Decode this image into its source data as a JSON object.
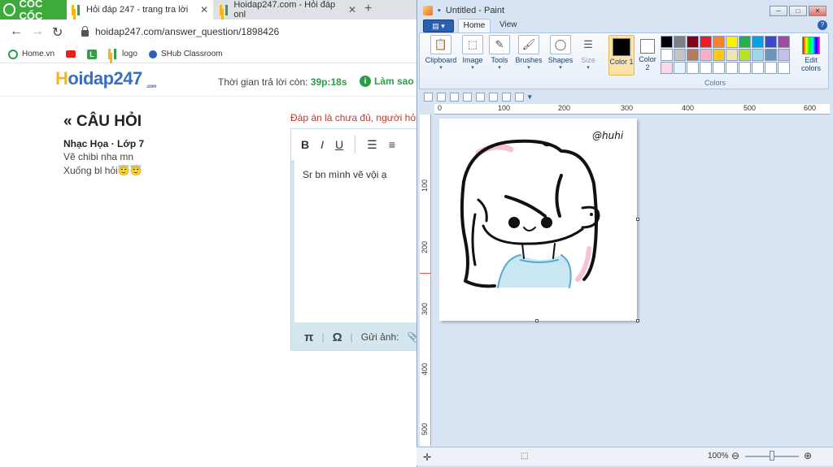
{
  "browser": {
    "brand": "CỐC CỐC",
    "tabs": [
      {
        "title": "Hỏi đáp 247 - trang tra lời",
        "active": true
      },
      {
        "title": "Hoidap247.com - Hỏi đáp onl",
        "active": false
      }
    ],
    "url": "hoidap247.com/answer_question/1898426",
    "bookmarks": [
      "Home.vn",
      "L",
      "logo",
      "SHub Classroom"
    ],
    "icons": {
      "back": "arrow-left-icon",
      "forward": "arrow-right-icon",
      "reload": "reload-icon",
      "new_tab": "plus-icon",
      "close": "close-icon"
    }
  },
  "page": {
    "logo_main_a": "H",
    "logo_main_b": "oidap247",
    "logo_sub": ".com",
    "timer_label": "Thời gian trả lời còn:",
    "timer_value": "39p:18s",
    "hint": "Làm sao",
    "question_header": "CÂU HỎI",
    "question_meta": "Nhạc Họa · Lớp 7",
    "question_lines": [
      "Vẽ chibi nha mn",
      "Xuống bl hỏi😇😇"
    ],
    "warning": "Đáp án là chưa đủ, người hỏi",
    "editor": {
      "tools": [
        "B",
        "I",
        "U"
      ],
      "content": "Sr bn mình vẽ vội ạ",
      "bottom_pi": "π",
      "bottom_omega": "Ω",
      "send_image": "Gửi ảnh:"
    }
  },
  "paint": {
    "title": "Untitled - Paint",
    "tabs": [
      "Home",
      "View"
    ],
    "groups": [
      "Clipboard",
      "Image",
      "Tools",
      "Brushes",
      "Shapes",
      "Size"
    ],
    "color1": "Color 1",
    "color2": "Color 2",
    "colors_label": "Colors",
    "edit_colors": "Edit colors",
    "palette": [
      "#000000",
      "#7f7f7f",
      "#880015",
      "#ed1c24",
      "#ff7f27",
      "#fff200",
      "#22b14c",
      "#00a2e8",
      "#3f48cc",
      "#a349a4",
      "#ffffff",
      "#c3c3c3",
      "#b97a57",
      "#ffaec9",
      "#ffc90e",
      "#efe4b0",
      "#b5e61d",
      "#99d9ea",
      "#7092be",
      "#c8bfe7",
      "#ffd6e4",
      "#e8f4fb",
      "#ffffff",
      "#ffffff",
      "#ffffff",
      "#ffffff",
      "#ffffff",
      "#ffffff",
      "#ffffff",
      "#ffffff"
    ],
    "ruler_h": [
      "0",
      "100",
      "200",
      "300",
      "400",
      "500",
      "600"
    ],
    "ruler_v": [
      "100",
      "200",
      "300",
      "400",
      "500"
    ],
    "signature": "@huhi",
    "zoom": "100%",
    "window_buttons": [
      "minimize-icon",
      "maximize-icon",
      "close-icon"
    ]
  }
}
